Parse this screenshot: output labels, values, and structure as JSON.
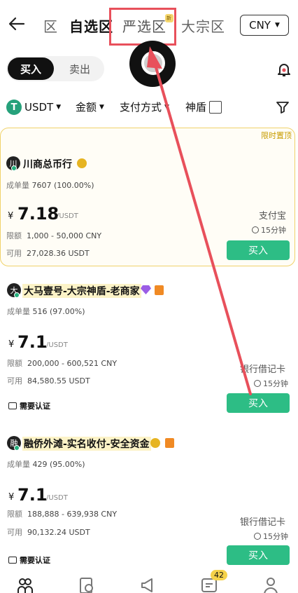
{
  "header": {
    "tab_zone": "区",
    "tab_watchlist": "自选区",
    "tab_selected": "严选区",
    "tab_new_badge": "新",
    "tab_bulk": "大宗区",
    "currency": "CNY"
  },
  "mode_switch": {
    "buy": "买入",
    "sell": "卖出"
  },
  "filters": {
    "asset": "USDT",
    "amount": "金额",
    "payment": "支付方式",
    "shield": "神盾"
  },
  "merchants": [
    {
      "avatar_char": "川",
      "name": "川商总币行",
      "pinned_label": "限时置顶",
      "orders_label": "成单量",
      "orders": "7607 (100.00%)",
      "currency_symbol": "¥",
      "price": "7.18",
      "unit": "/USDT",
      "limit_label": "限额",
      "limit": "1,000 - 50,000 CNY",
      "available_label": "可用",
      "available": "27,028.36 USDT",
      "payment": "支付宝",
      "time": "15分钟",
      "buy_label": "买入"
    },
    {
      "avatar_char": "大",
      "name": "大马壹号-大宗神盾-老商家",
      "orders_label": "成单量",
      "orders": "516 (97.00%)",
      "currency_symbol": "¥",
      "price": "7.1",
      "unit": "/USDT",
      "limit_label": "限额",
      "limit": "200,000 - 600,521 CNY",
      "available_label": "可用",
      "available": "84,580.55 USDT",
      "payment": "银行借记卡",
      "time": "15分钟",
      "verify": "需要认证",
      "buy_label": "买入"
    },
    {
      "avatar_char": "融",
      "name": "融侨外滩-实名收付-安全资金",
      "orders_label": "成单量",
      "orders": "429 (95.00%)",
      "currency_symbol": "¥",
      "price": "7.1",
      "unit": "/USDT",
      "limit_label": "限额",
      "limit": "188,888 - 639,938 CNY",
      "available_label": "可用",
      "available": "90,132.24 USDT",
      "payment": "银行借记卡",
      "time": "15分钟",
      "verify": "需要认证",
      "buy_label": "买入"
    }
  ],
  "bottom_nav": {
    "chat_badge": "42"
  },
  "colors": {
    "accent_green": "#2dbd85",
    "highlight_red": "#e8505b",
    "pinned_border": "#f0d26a"
  }
}
